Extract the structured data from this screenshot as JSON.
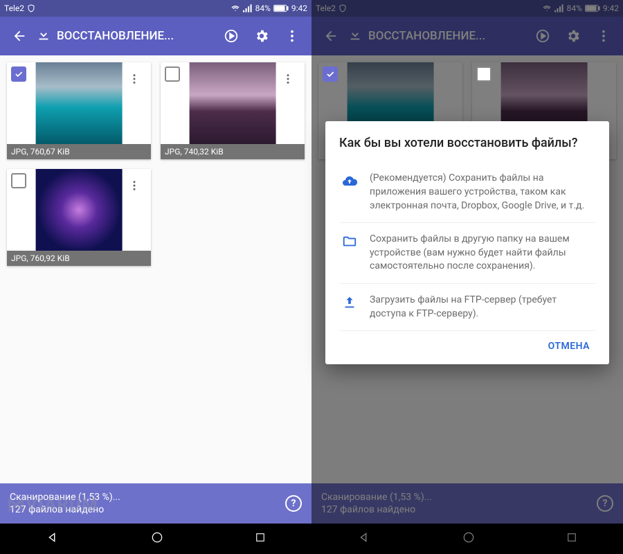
{
  "statusbar": {
    "carrier": "Tele2",
    "battery_pct": "84%",
    "time": "9:42"
  },
  "appbar": {
    "title": "ВОССТАНОВЛЕНИЕ..."
  },
  "items": [
    {
      "checked": true,
      "caption": "JPG, 760,67 KiB"
    },
    {
      "checked": false,
      "caption": "JPG, 740,32 KiB"
    },
    {
      "checked": false,
      "caption": "JPG, 760,92 KiB"
    }
  ],
  "footer": {
    "scan_line": "Сканирование (1,53 %)...",
    "found_line": "127 файлов найдено"
  },
  "dialog": {
    "title": "Как бы вы хотели восстановить файлы?",
    "opt_cloud": "(Рекомендуется) Сохранить файлы на приложения вашего устройства, таком как электронная почта, Dropbox, Google Drive, и т.д.",
    "opt_folder": "Сохранить файлы в другую папку на вашем устройстве (вам нужно будет найти файлы самостоятельно после сохранения).",
    "opt_ftp": "Загрузить файлы на FTP-сервер (требует доступа к FTP-серверу).",
    "cancel": "ОТМЕНА"
  },
  "watermark": "⋈VIARUM"
}
